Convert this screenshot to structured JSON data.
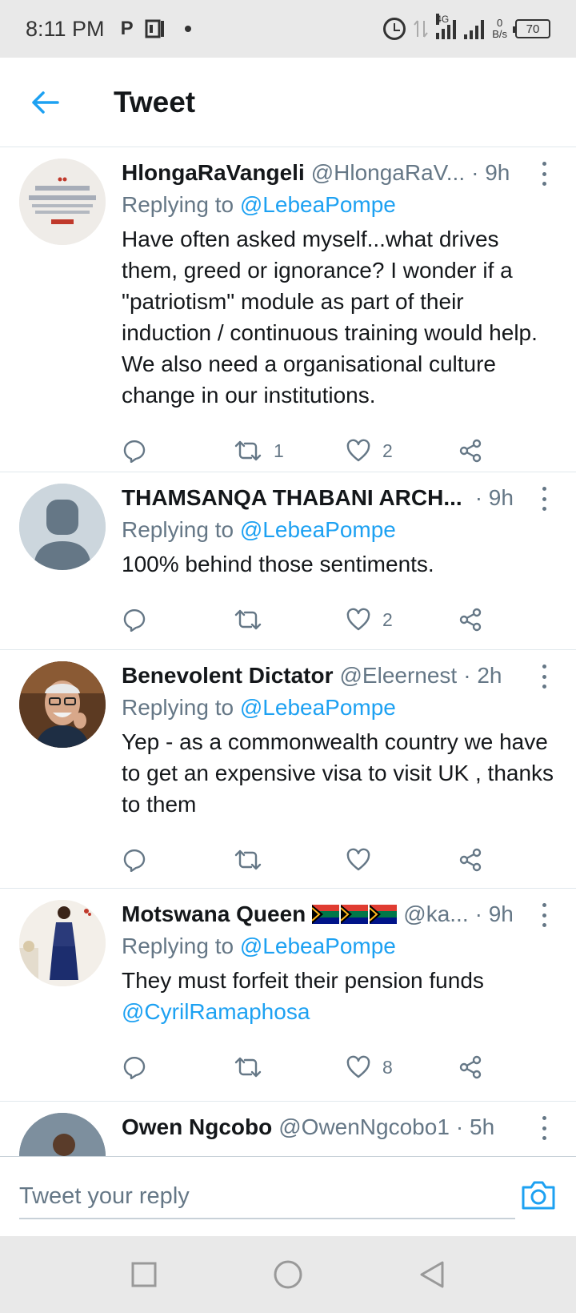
{
  "status_bar": {
    "time": "8:11 PM",
    "network": "4G",
    "speed_value": "0",
    "speed_unit": "B/s",
    "battery": "70"
  },
  "header": {
    "title": "Tweet"
  },
  "tweets": [
    {
      "name": "HlongaRaVangeli",
      "handle": "@HlongaRaV...",
      "time": "· 9h",
      "replying_prefix": "Replying to ",
      "replying_to": "@LebeaPompe",
      "text": "Have often asked myself...what drives them, greed or ignorance? I wonder if a \"patriotism\" module as part of their induction / continuous training would help. We also need a organisational culture change in our institutions.",
      "retweets": "1",
      "likes": "2",
      "avatar_text": "LOYALTY TO COUNTRY ALWAYS. LOYALTY TO GOVERNMENT, WHEN IT DESERVES IT."
    },
    {
      "name": "THAMSANQA THABANI ARCH...",
      "handle": "",
      "time": "· 9h",
      "replying_prefix": "Replying to ",
      "replying_to": "@LebeaPompe",
      "text": "100% behind those sentiments.",
      "retweets": "",
      "likes": "2"
    },
    {
      "name": "Benevolent Dictator",
      "handle": "@Eleernest",
      "time": "· 2h",
      "replying_prefix": "Replying to ",
      "replying_to": "@LebeaPompe",
      "text": "Yep -  as a commonwealth country we have to get an expensive visa to visit UK , thanks to them",
      "retweets": "",
      "likes": ""
    },
    {
      "name": "Motswana Queen",
      "handle": "@ka...",
      "time": "· 9h",
      "replying_prefix": "Replying to ",
      "replying_to": "@LebeaPompe",
      "text": "They must forfeit their pension funds",
      "mention": "@CyrilRamaphosa",
      "retweets": "",
      "likes": "8"
    },
    {
      "name": "Owen Ngcobo",
      "handle": "@OwenNgcobo1",
      "time": "· 5h"
    }
  ],
  "reply_bar": {
    "placeholder": "Tweet your reply"
  },
  "colors": {
    "accent": "#1da1f2",
    "secondary_text": "#657786",
    "divider": "#e1e8ed"
  }
}
